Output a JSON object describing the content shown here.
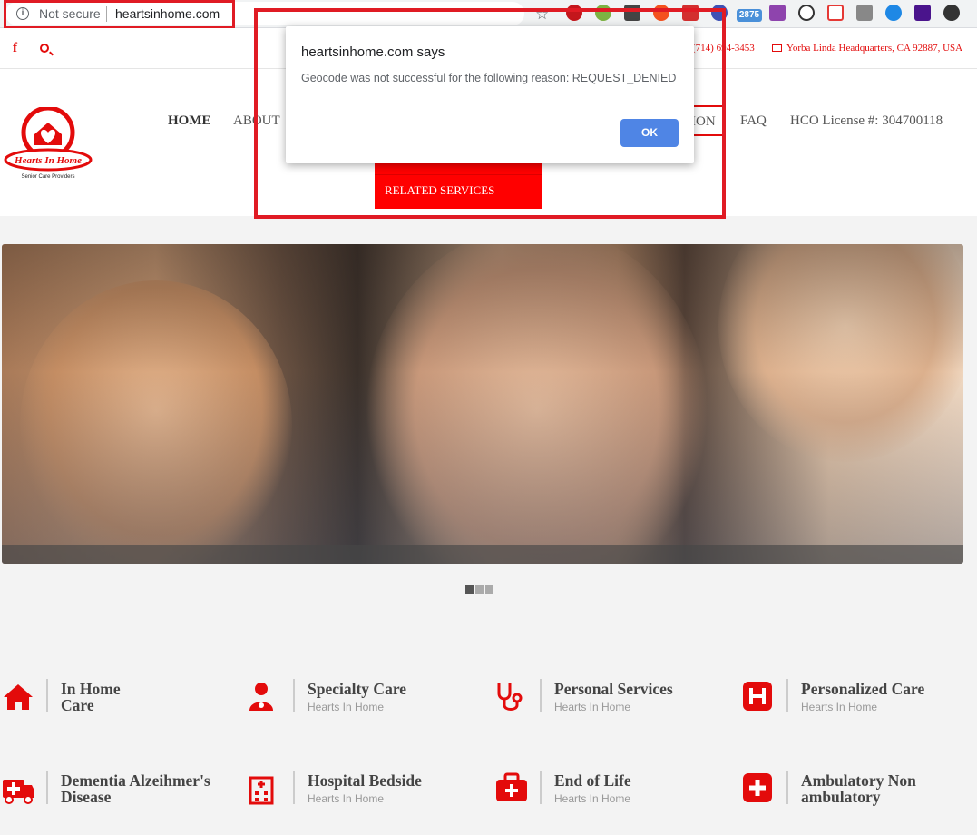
{
  "browser": {
    "security_label": "Not secure",
    "url": "heartsinhome.com",
    "badge_count": "2875"
  },
  "topbar": {
    "phone": "(714) 694-3453",
    "address": "Yorba Linda Headquarters, CA 92887, USA"
  },
  "logo": {
    "name": "Hearts In Home",
    "tagline": "Senior Care Providers"
  },
  "nav": {
    "home": "HOME",
    "about": "ABOUT",
    "partial": "ION",
    "faq": "FAQ",
    "license": "HCO License #: 304700118",
    "dropdown_item": "RELATED SERVICES"
  },
  "dialog": {
    "title": "heartsinhome.com says",
    "message": "Geocode was not successful for the following reason: REQUEST_DENIED",
    "ok_label": "OK"
  },
  "carousel": {
    "dot_count": 3,
    "active_index": 0
  },
  "services": [
    {
      "title": "In Home Care",
      "subtitle": "",
      "icon": "house-icon"
    },
    {
      "title": "Specialty Care",
      "subtitle": "Hearts In Home",
      "icon": "doctor-icon"
    },
    {
      "title": "Personal Services",
      "subtitle": "Hearts In Home",
      "icon": "stethoscope-icon"
    },
    {
      "title": "Personalized Care",
      "subtitle": "Hearts In Home",
      "icon": "hospital-h-icon"
    },
    {
      "title": "Dementia Alzeihmer's Disease",
      "subtitle": "",
      "icon": "ambulance-icon"
    },
    {
      "title": "Hospital Bedside",
      "subtitle": "Hearts In Home",
      "icon": "hospital-building-icon"
    },
    {
      "title": "End of Life",
      "subtitle": "Hearts In Home",
      "icon": "medkit-icon"
    },
    {
      "title": "Ambulatory Non ambulatory",
      "subtitle": "",
      "icon": "plus-square-icon"
    }
  ],
  "colors": {
    "brand_red": "#e30b0b",
    "dropdown_red": "#ff0000",
    "ok_blue": "#4f85e5",
    "highlight_red": "#e01b24"
  }
}
